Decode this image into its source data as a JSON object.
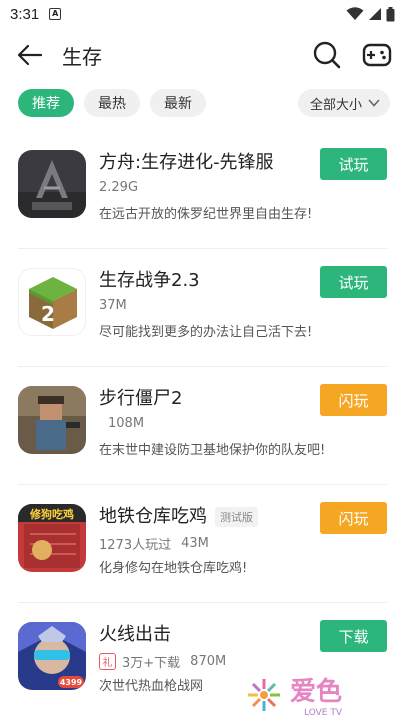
{
  "status": {
    "time": "3:31",
    "notification_icon": "A"
  },
  "header": {
    "title": "生存",
    "back_icon": "arrow-left-icon",
    "search_icon": "search-icon",
    "gamepad_icon": "gamepad-icon"
  },
  "filters": {
    "chips": [
      "推荐",
      "最热",
      "最新"
    ],
    "active_index": 0,
    "size_select": "全部大小"
  },
  "colors": {
    "accent_green": "#2db67c",
    "accent_orange": "#f5a623"
  },
  "games": [
    {
      "name": "方舟:生存进化-先锋服",
      "meta": [
        "2.29G"
      ],
      "description": "在远古开放的侏罗纪世界里自由生存!",
      "action": "试玩",
      "action_color": "green"
    },
    {
      "name": "生存战争2.3",
      "meta": [
        "37M"
      ],
      "description": "尽可能找到更多的办法让自己活下去!",
      "action": "试玩",
      "action_color": "green"
    },
    {
      "name": "步行僵尸2",
      "meta": [
        "108M"
      ],
      "description": "在末世中建设防卫基地保护你的队友吧!",
      "action": "闪玩",
      "action_color": "orange"
    },
    {
      "name": "地铁仓库吃鸡",
      "badge": "测试版",
      "meta": [
        "1273人玩过",
        "43M"
      ],
      "description": "化身修勾在地铁仓库吃鸡!",
      "action": "闪玩",
      "action_color": "orange",
      "icon_text": "修狗吃鸡"
    },
    {
      "name": "火线出击",
      "gift_label": "礼",
      "meta": [
        "3万+下载",
        "870M"
      ],
      "description": "次世代热血枪战网",
      "action": "下载",
      "action_color": "green",
      "icon_text": "4399"
    }
  ],
  "watermark": {
    "text": "爱色",
    "subtext": "LOVE TV"
  }
}
